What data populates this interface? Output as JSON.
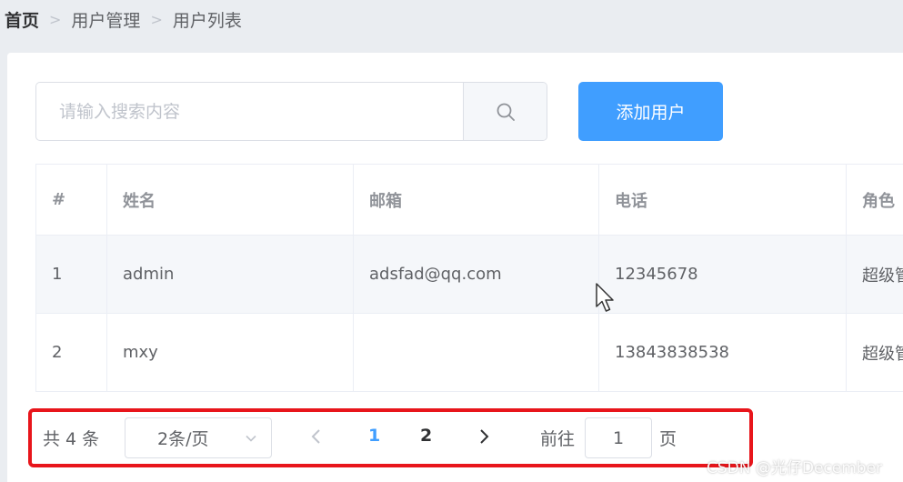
{
  "breadcrumb": {
    "items": [
      "首页",
      "用户管理",
      "用户列表"
    ],
    "separator": ">"
  },
  "search": {
    "placeholder": "请输入搜索内容",
    "value": "",
    "icon": "search-icon"
  },
  "toolbar": {
    "add_user_label": "添加用户"
  },
  "table": {
    "columns": [
      "#",
      "姓名",
      "邮箱",
      "电话",
      "角色"
    ],
    "rows": [
      [
        "1",
        "admin",
        "adsfad@qq.com",
        "12345678",
        "超级管"
      ],
      [
        "2",
        "mxy",
        "",
        "13843838538",
        "超级管"
      ]
    ]
  },
  "pagination": {
    "total_label": "共 4 条",
    "page_size": "2条/页",
    "pages": [
      "1",
      "2"
    ],
    "current_page": "1",
    "goto_label": "前往",
    "goto_value": "1",
    "page_suffix": "页"
  },
  "watermark": "CSDN @光仔December",
  "colors": {
    "primary": "#409eff",
    "highlight_border": "#e8151b",
    "background": "#eaedf1"
  }
}
